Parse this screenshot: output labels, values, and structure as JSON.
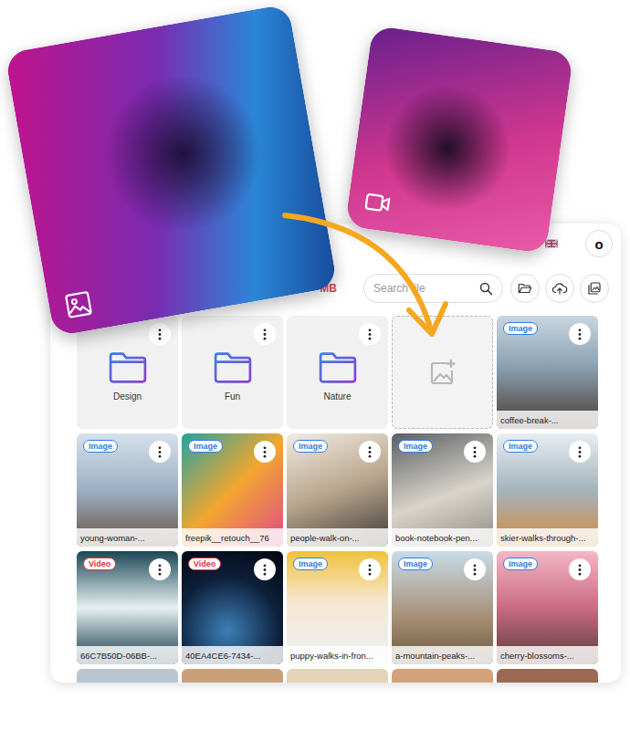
{
  "panel": {
    "storage": "MB",
    "search": {
      "placeholder": "Search file"
    },
    "avatar": "o"
  },
  "floating_media": [
    {
      "kind": "image"
    },
    {
      "kind": "video"
    }
  ],
  "grid": [
    {
      "kind": "folder",
      "name": "Design"
    },
    {
      "kind": "folder",
      "name": "Fun"
    },
    {
      "kind": "folder",
      "name": "Nature"
    },
    {
      "kind": "dropzone"
    },
    {
      "kind": "file",
      "badge": "Image",
      "color": "#2f7de1",
      "name": "coffee-break-..."
    },
    {
      "kind": "file",
      "badge": "Image",
      "color": "#2f7de1",
      "name": "young-woman-..."
    },
    {
      "kind": "file",
      "badge": "Image",
      "color": "#2f7de1",
      "name": "freepik__retouch__76"
    },
    {
      "kind": "file",
      "badge": "Image",
      "color": "#2f7de1",
      "name": "people-walk-on-..."
    },
    {
      "kind": "file",
      "badge": "Image",
      "color": "#2f7de1",
      "name": "book-notebook-pen..."
    },
    {
      "kind": "file",
      "badge": "Image",
      "color": "#2f7de1",
      "name": "skier-walks-through-..."
    },
    {
      "kind": "file",
      "badge": "Video",
      "color": "#e0323a",
      "name": "66C7B50D-06BB-..."
    },
    {
      "kind": "file",
      "badge": "Video",
      "color": "#e0323a",
      "name": "40EA4CE6-7434-..."
    },
    {
      "kind": "file",
      "badge": "Image",
      "color": "#2f7de1",
      "name": "puppy-walks-in-fron..."
    },
    {
      "kind": "file",
      "badge": "Image",
      "color": "#2f7de1",
      "name": "a-mountain-peaks-..."
    },
    {
      "kind": "file",
      "badge": "Image",
      "color": "#2f7de1",
      "name": "cherry-blossoms-..."
    },
    {
      "kind": "partial"
    },
    {
      "kind": "partial"
    },
    {
      "kind": "partial"
    },
    {
      "kind": "partial"
    },
    {
      "kind": "partial"
    }
  ]
}
